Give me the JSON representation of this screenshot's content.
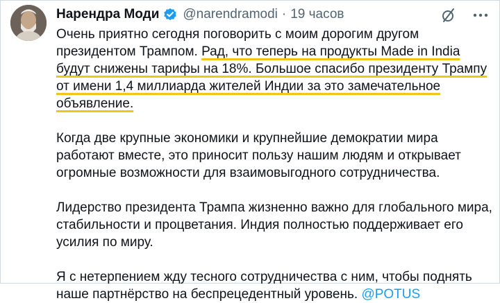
{
  "author": {
    "name": "Нарендра Моди",
    "handle": "@narendramodi",
    "separator": "·",
    "time": "19 часов"
  },
  "icons": {
    "verified": "verified-badge-icon",
    "no_edit": "slashed-circle-icon",
    "more": "more-dots-icon"
  },
  "colors": {
    "accent": "#1d9bf0",
    "highlight": "#f2c51a",
    "text": "#0f1419",
    "muted": "#536471"
  },
  "tweet": {
    "p1_plain": "Очень приятно сегодня поговорить с моим дорогим другом президентом Трампом. ",
    "p1_highlight": "Рад, что теперь на продукты Made in India будут снижены тарифы на 18%. Большое спасибо президенту Трампу от имени 1,4 миллиарда жителей Индии за это замечательное объявление.",
    "p2": "Когда две крупные экономики и крупнейшие демократии мира работают вместе, это приносит пользу нашим людям и открывает огромные возможности для взаимовыгодного сотрудничества.",
    "p3": "Лидерство президента Трампа жизненно важно для глобального мира, стабильности и процветания. Индия полностью поддерживает его усилия по миру.",
    "p4_text": "Я с нетерпением жду тесного сотрудничества с ним, чтобы поднять наше партнёрство на беспрецедентный уровень. ",
    "p4_mention": "@POTUS"
  }
}
